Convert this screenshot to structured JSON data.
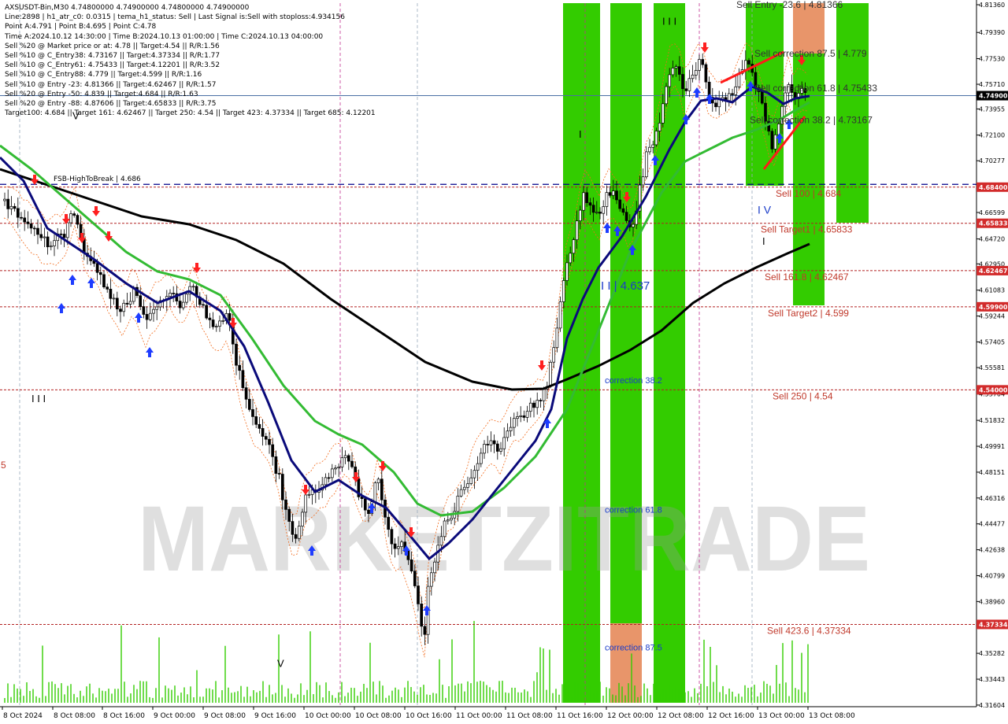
{
  "symbol_header": "AXSUSDT-Bin,M30  4.74800000 4.74900000 4.74800000 4.74900000",
  "info_lines": [
    "Line:2898  |  h1_atr_c0: 0.0315  |  tema_h1_status: Sell  |  Last Signal is:Sell with stoploss:4.934156",
    "Point A:4.791  |  Point B:4.695  |  Point C:4.78",
    "Time A:2024.10.12 14:30:00  |  Time B:2024.10.13 01:00:00  |  Time C:2024.10.13 04:00:00",
    "Sell %20 @ Market price or at: 4.78  ||  Target:4.54  ||  R/R:1.56",
    "Sell %10 @ C_Entry38: 4.73167  ||  Target:4.37334  ||  R/R:1.77",
    "Sell %10 @ C_Entry61: 4.75433  ||  Target:4.12201  ||  R/R:3.52",
    "Sell %10 @ C_Entry88: 4.779  ||  Target:4.599  ||  R/R:1.16",
    "Sell %10 @ Entry -23: 4.81366  ||  Target:4.62467  ||  R/R:1.57",
    "Sell %20 @ Entry -50: 4.839  ||  Target:4.684  ||  R/R:1.63",
    "Sell %20 @ Entry -88: 4.87606  ||  Target:4.65833  ||  R/R:3.75",
    "Target100: 4.684  ||  Target 161: 4.62467  ||  Target 250: 4.54  ||  Target 423: 4.37334  ||  Target 685: 4.12201"
  ],
  "watermark": "MARKETZITRADE",
  "colors": {
    "green_zone": "#33cc00",
    "orange_zone": "#e8956a",
    "level_line": "#b22222",
    "fsb_line": "#00008b",
    "price_line": "#4a6fa5",
    "ma_black": "#000000",
    "ma_green": "#33bb33",
    "ma_navy": "#0a0a7a",
    "up_candle": "#000000",
    "down_candle": "#000000",
    "arrow_up": "#1e3cff",
    "arrow_down": "#ff2020",
    "volume": "#33cc00"
  },
  "chart_data": {
    "type": "candlestick",
    "symbol": "AXSUSDT-Bin",
    "timeframe": "M30",
    "ylim": [
      4.316,
      4.8136
    ],
    "y_ticks": [
      "4.81360",
      "4.79390",
      "4.77530",
      "4.75710",
      "4.73955",
      "4.72100",
      "4.70277",
      "4.68400",
      "4.66599",
      "4.64720",
      "4.62950",
      "4.61083",
      "4.59244",
      "4.57405",
      "4.55581",
      "4.53704",
      "4.51832",
      "4.49991",
      "4.48151",
      "4.46316",
      "4.44477",
      "4.42638",
      "4.40799",
      "4.38960",
      "4.37334",
      "4.35282",
      "4.33443",
      "4.31604"
    ],
    "current_price": "4.74900",
    "price_badges": [
      {
        "label": "4.74900",
        "value": 4.749,
        "color": "#000000"
      },
      {
        "label": "4.68400",
        "value": 4.684,
        "color": "#d22b2b"
      },
      {
        "label": "4.65833",
        "value": 4.65833,
        "color": "#d22b2b"
      },
      {
        "label": "4.62467",
        "value": 4.62467,
        "color": "#d22b2b"
      },
      {
        "label": "4.59900",
        "value": 4.599,
        "color": "#d22b2b"
      },
      {
        "label": "4.54000",
        "value": 4.54,
        "color": "#d22b2b"
      },
      {
        "label": "4.37334",
        "value": 4.37334,
        "color": "#d22b2b"
      }
    ],
    "x_labels": [
      "8 Oct 2024",
      "8 Oct 08:00",
      "8 Oct 16:00",
      "9 Oct 00:00",
      "9 Oct 08:00",
      "9 Oct 16:00",
      "10 Oct 00:00",
      "10 Oct 08:00",
      "10 Oct 16:00",
      "11 Oct 00:00",
      "11 Oct 08:00",
      "11 Oct 16:00",
      "12 Oct 00:00",
      "12 Oct 08:00",
      "12 Oct 16:00",
      "13 Oct 00:00",
      "13 Oct 08:00"
    ],
    "levels": [
      {
        "label": "Sell 100 | 4.684",
        "value": 4.684
      },
      {
        "label": "Sell Target1 | 4.65833",
        "value": 4.65833
      },
      {
        "label": "Sell 161.8 | 4.62467",
        "value": 4.62467
      },
      {
        "label": "Sell Target2 | 4.599",
        "value": 4.599
      },
      {
        "label": "Sell  250 | 4.54",
        "value": 4.54
      },
      {
        "label": "Sell  423.6 | 4.37334",
        "value": 4.37334
      }
    ],
    "fsb_line": {
      "label": "FSB-HighToBreak | 4.686",
      "value": 4.686
    },
    "entry_labels": [
      {
        "label": "Sell Entry -23.6 | 4.81366",
        "value": 4.81366
      },
      {
        "label": "Sell correction 87.5 | 4.779",
        "value": 4.779
      },
      {
        "label": "Sell correction 61.8 | 4.75433",
        "value": 4.75433
      },
      {
        "label": "Sell correction 38.2 | 4.73167",
        "value": 4.73167
      }
    ],
    "correction_labels": [
      {
        "label": "correction 38.2",
        "value": 4.547
      },
      {
        "label": "correction 61.8",
        "value": 4.455
      },
      {
        "label": "correction 87.5",
        "value": 4.357
      }
    ],
    "wave_labels": [
      {
        "label": "I I I",
        "value": 4.802
      },
      {
        "label": "I",
        "value": 4.722
      },
      {
        "label": "I V",
        "value": 4.668
      },
      {
        "label": "I",
        "value": 4.646
      },
      {
        "label": "I I | 4.637",
        "value": 4.614
      },
      {
        "label": "I I I",
        "value": 4.534
      },
      {
        "label": "V",
        "value": 4.346
      },
      {
        "label": "V",
        "value": 4.735
      },
      {
        "label": "5",
        "value": 4.487
      }
    ]
  }
}
